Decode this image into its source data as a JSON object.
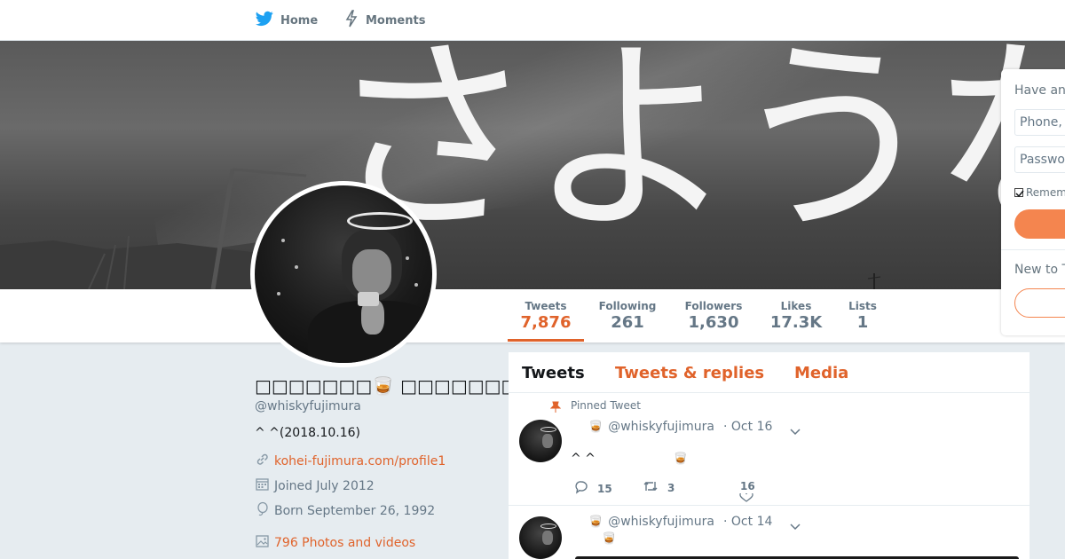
{
  "nav": {
    "home_label": "Home",
    "moments_label": "Moments"
  },
  "banner": {
    "text": "さようなら"
  },
  "stats": [
    {
      "label": "Tweets",
      "value": "7,876"
    },
    {
      "label": "Following",
      "value": "261"
    },
    {
      "label": "Followers",
      "value": "1,630"
    },
    {
      "label": "Likes",
      "value": "17.3K"
    },
    {
      "label": "Lists",
      "value": "1"
    }
  ],
  "profile": {
    "name": "□□□□□□□🥃 □□□□□□□",
    "handle": "@whiskyfujimura",
    "bio": "^ ^(2018.10.16)",
    "website": "kohei-fujimura.com/profile1",
    "joined": "Joined July 2012",
    "born": "Born September 26, 1992",
    "media": "796 Photos and videos"
  },
  "timeline": {
    "tabs": [
      "Tweets",
      "Tweets & replies",
      "Media"
    ],
    "tweets": [
      {
        "pinned_label": "Pinned Tweet",
        "emoji": "🥃",
        "handle": "@whiskyfujimura",
        "date": "· Oct 16",
        "text": "^ ^",
        "text_emoji": "🥃",
        "replies": "15",
        "retweets": "3",
        "likes": "16"
      },
      {
        "emoji": "🥃",
        "handle": "@whiskyfujimura",
        "date": "· Oct 14",
        "text_emoji": "🥃"
      }
    ]
  },
  "login": {
    "heading": "Have an",
    "phone_placeholder": "Phone,",
    "password_placeholder": "Passwo",
    "remember_label": "Remem",
    "new_label": "New to T"
  },
  "colors": {
    "accent": "#e0632b",
    "nav_blue": "#1da1f2",
    "login_button": "#f4854f"
  },
  "icons": {
    "home": "twitter-bird-icon",
    "moments": "lightning-icon",
    "website": "link-icon",
    "joined": "calendar-icon",
    "born": "balloon-icon",
    "media": "image-icon",
    "pinned": "pin-icon",
    "reply": "reply-icon",
    "retweet": "retweet-icon",
    "like": "heart-icon",
    "more": "chevron-down-icon"
  }
}
